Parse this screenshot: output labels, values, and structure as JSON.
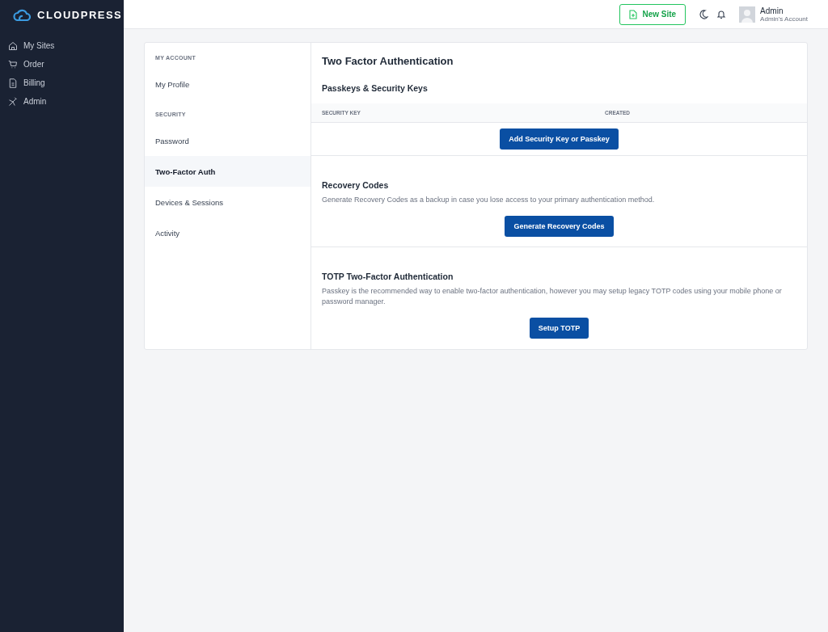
{
  "brand": {
    "name": "CLOUDPRESS"
  },
  "sidebar": {
    "items": [
      {
        "label": "My Sites"
      },
      {
        "label": "Order"
      },
      {
        "label": "Billing"
      },
      {
        "label": "Admin"
      }
    ]
  },
  "header": {
    "new_site_button": "New Site",
    "user": {
      "name": "Admin",
      "subtitle": "Admin's Account"
    }
  },
  "settings_nav": {
    "groups": [
      {
        "heading": "MY ACCOUNT",
        "items": [
          {
            "label": "My Profile",
            "selected": false
          }
        ]
      },
      {
        "heading": "SECURITY",
        "items": [
          {
            "label": "Password",
            "selected": false
          },
          {
            "label": "Two-Factor Auth",
            "selected": true
          },
          {
            "label": "Devices & Sessions",
            "selected": false
          },
          {
            "label": "Activity",
            "selected": false
          }
        ]
      }
    ]
  },
  "content": {
    "title": "Two Factor Authentication",
    "passkeys": {
      "heading": "Passkeys & Security Keys",
      "columns": [
        "SECURITY KEY",
        "CREATED"
      ],
      "button": "Add Security Key or Passkey"
    },
    "recovery": {
      "heading": "Recovery Codes",
      "description": "Generate Recovery Codes as a backup in case you lose access to your primary authentication method.",
      "button": "Generate Recovery Codes"
    },
    "totp": {
      "heading": "TOTP Two-Factor Authentication",
      "description": "Passkey is the recommended way to enable two-factor authentication, however you may setup legacy TOTP codes using your mobile phone or password manager.",
      "button": "Setup TOTP"
    }
  }
}
